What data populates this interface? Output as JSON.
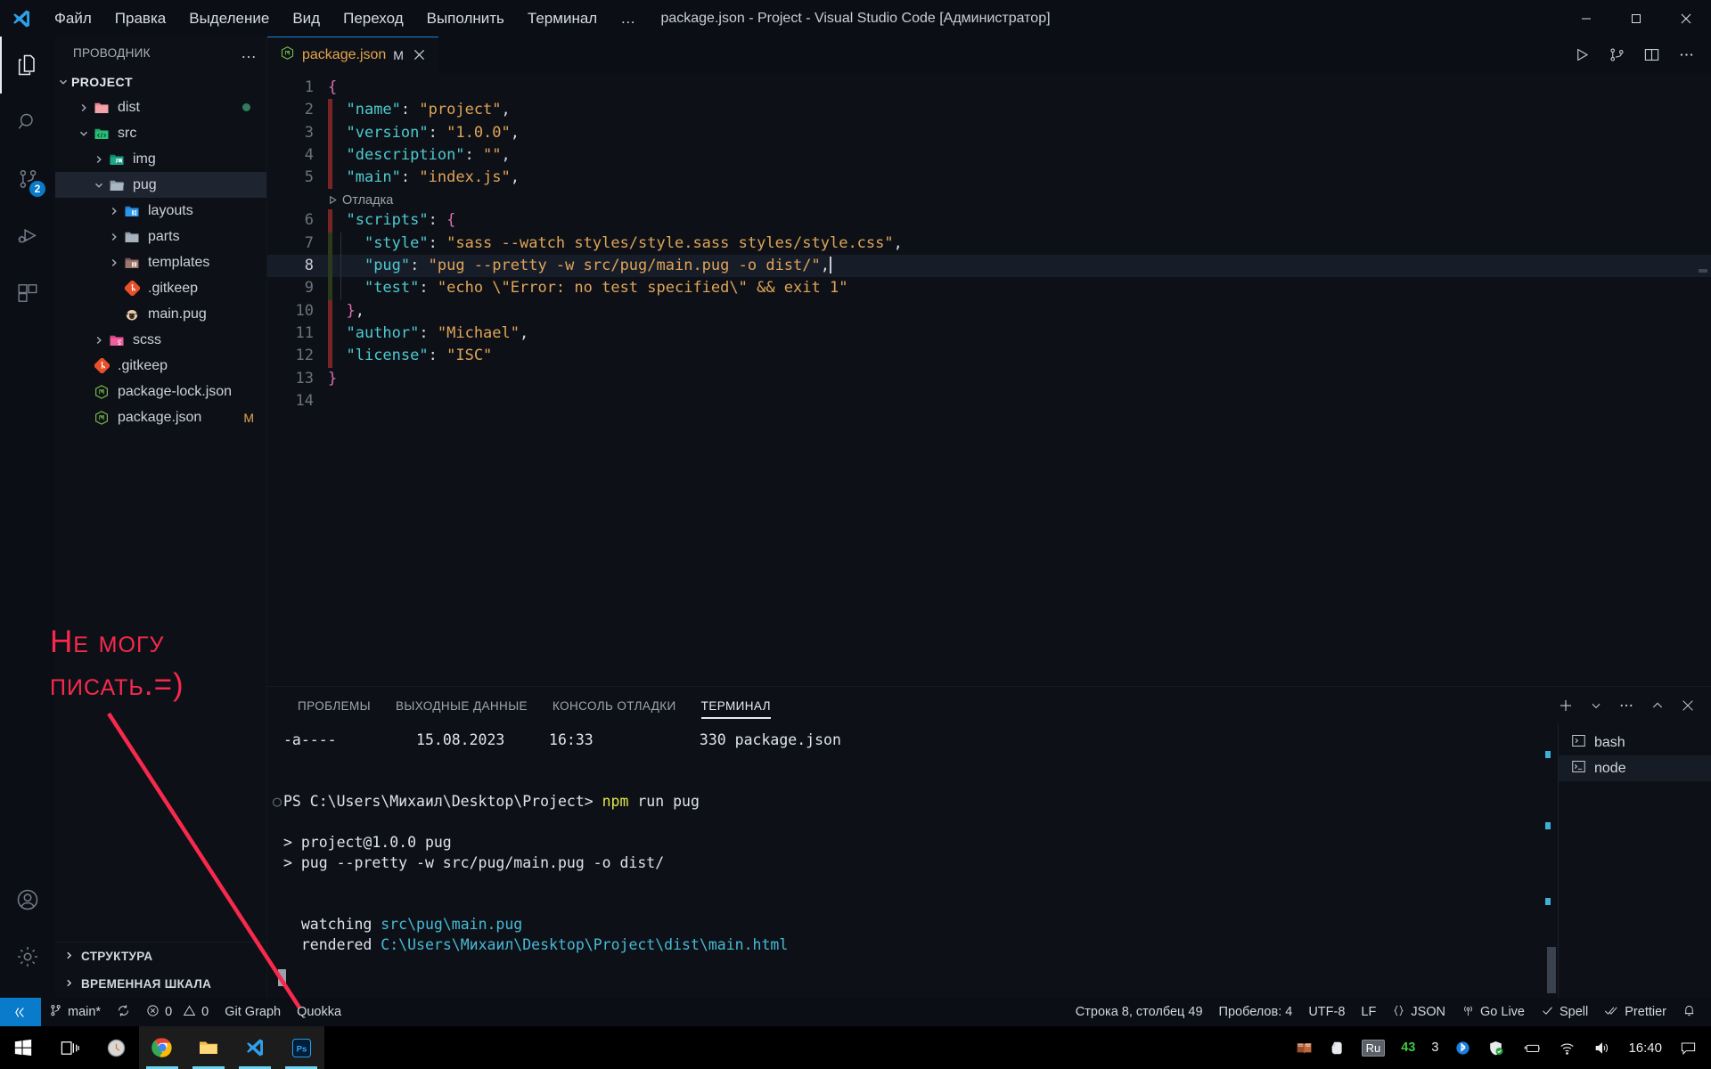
{
  "window": {
    "title": "package.json - Project - Visual Studio Code [Администратор]",
    "minimize": "minimize-icon",
    "maximize": "maximize-icon",
    "close": "close-icon"
  },
  "menu": {
    "items": [
      "Файл",
      "Правка",
      "Выделение",
      "Вид",
      "Переход",
      "Выполнить",
      "Терминал",
      "…"
    ]
  },
  "activitybar": {
    "items": [
      {
        "name": "explorer",
        "icon": "files-icon",
        "badge": ""
      },
      {
        "name": "search",
        "icon": "search-icon",
        "badge": ""
      },
      {
        "name": "source-control",
        "icon": "source-control-icon",
        "badge": "2"
      },
      {
        "name": "run-debug",
        "icon": "run-debug-icon",
        "badge": ""
      },
      {
        "name": "extensions",
        "icon": "extensions-icon",
        "badge": ""
      }
    ],
    "bottom": [
      {
        "name": "accounts",
        "icon": "account-icon"
      },
      {
        "name": "settings",
        "icon": "gear-icon"
      }
    ]
  },
  "sidebar": {
    "title": "ПРОВОДНИК",
    "more": "…",
    "root": "PROJECT",
    "tree": [
      {
        "label": "dist",
        "indent": 1,
        "type": "folder",
        "state": "collapsed",
        "icon": "folder-dist-icon",
        "badge": "",
        "dot": true
      },
      {
        "label": "src",
        "indent": 1,
        "type": "folder",
        "state": "expanded",
        "icon": "folder-src-icon",
        "badge": "",
        "dot": false
      },
      {
        "label": "img",
        "indent": 2,
        "type": "folder",
        "state": "collapsed",
        "icon": "folder-img-icon",
        "badge": "",
        "dot": false
      },
      {
        "label": "pug",
        "indent": 2,
        "type": "folder",
        "state": "expanded",
        "icon": "folder-open-icon",
        "badge": "",
        "dot": false,
        "selected": true
      },
      {
        "label": "layouts",
        "indent": 3,
        "type": "folder",
        "state": "collapsed",
        "icon": "folder-layout-icon",
        "badge": "",
        "dot": false
      },
      {
        "label": "parts",
        "indent": 3,
        "type": "folder",
        "state": "collapsed",
        "icon": "folder-plain-icon",
        "badge": "",
        "dot": false
      },
      {
        "label": "templates",
        "indent": 3,
        "type": "folder",
        "state": "collapsed",
        "icon": "folder-tmpl-icon",
        "badge": "",
        "dot": false
      },
      {
        "label": ".gitkeep",
        "indent": 3,
        "type": "file",
        "state": "",
        "icon": "git-icon",
        "badge": "",
        "dot": false
      },
      {
        "label": "main.pug",
        "indent": 3,
        "type": "file",
        "state": "",
        "icon": "pug-icon",
        "badge": "",
        "dot": false
      },
      {
        "label": "scss",
        "indent": 2,
        "type": "folder",
        "state": "collapsed",
        "icon": "folder-sass-icon",
        "badge": "",
        "dot": false
      },
      {
        "label": ".gitkeep",
        "indent": 1,
        "type": "file",
        "state": "",
        "icon": "git-icon",
        "badge": "",
        "dot": false
      },
      {
        "label": "package-lock.json",
        "indent": 1,
        "type": "file",
        "state": "",
        "icon": "npm-icon",
        "badge": "",
        "dot": false
      },
      {
        "label": "package.json",
        "indent": 1,
        "type": "file",
        "state": "",
        "icon": "npm-icon",
        "badge": "M",
        "dot": false
      }
    ],
    "sections": [
      "СТРУКТУРА",
      "ВРЕМЕННАЯ ШКАЛА"
    ]
  },
  "editor": {
    "tab": {
      "label": "package.json",
      "modified": "M",
      "close": "close-icon",
      "icon": "npm-icon"
    },
    "actions": [
      "run-icon",
      "split-run-icon",
      "split-editor-icon",
      "more-actions-icon"
    ],
    "codelens": "Отладка",
    "lines": [
      {
        "n": "1",
        "text": "{"
      },
      {
        "n": "2",
        "text": "  \"name\": \"project\","
      },
      {
        "n": "3",
        "text": "  \"version\": \"1.0.0\","
      },
      {
        "n": "4",
        "text": "  \"description\": \"\","
      },
      {
        "n": "5",
        "text": "  \"main\": \"index.js\","
      },
      {
        "n": "6",
        "text": "  \"scripts\": {"
      },
      {
        "n": "7",
        "text": "    \"style\": \"sass --watch styles/style.sass styles/style.css\","
      },
      {
        "n": "8",
        "text": "    \"pug\": \"pug --pretty -w src/pug/main.pug -o dist/\","
      },
      {
        "n": "9",
        "text": "    \"test\": \"echo \\\"Error: no test specified\\\" && exit 1\""
      },
      {
        "n": "10",
        "text": "  },"
      },
      {
        "n": "11",
        "text": "  \"author\": \"Michael\","
      },
      {
        "n": "12",
        "text": "  \"license\": \"ISC\""
      },
      {
        "n": "13",
        "text": "}"
      },
      {
        "n": "14",
        "text": ""
      }
    ]
  },
  "annotation": {
    "line1": "Не могу",
    "line2": "писать.=)",
    "color": "#f8294c"
  },
  "panel": {
    "tabs": [
      {
        "label": "ПРОБЛЕМЫ",
        "active": false
      },
      {
        "label": "ВЫХОДНЫЕ ДАННЫЕ",
        "active": false
      },
      {
        "label": "КОНСОЛЬ ОТЛАДКИ",
        "active": false
      },
      {
        "label": "ТЕРМИНАЛ",
        "active": true
      }
    ],
    "actions": [
      "add-terminal-icon",
      "chevron-down-icon",
      "more-actions-icon",
      "chevron-up-icon",
      "close-icon"
    ],
    "terminal": {
      "lines": [
        {
          "text": "-a----         15.08.2023     16:33            330 package.json",
          "color": "white"
        },
        {
          "text": "",
          "color": "white"
        },
        {
          "text": "PS C:\\Users\\Михаил\\Desktop\\Project> npm run pug",
          "color": "prompt"
        },
        {
          "text": "",
          "color": "white"
        },
        {
          "text": "> project@1.0.0 pug",
          "color": "white"
        },
        {
          "text": "> pug --pretty -w src/pug/main.pug -o dist/",
          "color": "white"
        },
        {
          "text": "",
          "color": "white"
        },
        {
          "text": "",
          "color": "white"
        },
        {
          "text": "  watching src\\pug\\main.pug",
          "color": "watch"
        },
        {
          "text": "  rendered C:\\Users\\Михаил\\Desktop\\Project\\dist\\main.html",
          "color": "render"
        }
      ],
      "prompt_path": "PS C:\\Users\\Михаил\\Desktop\\Project>",
      "prompt_cmd_highlight": "npm",
      "prompt_cmd_rest": " run pug",
      "watch_label": "watching",
      "watch_path": "src\\pug\\main.pug",
      "render_label": "rendered",
      "render_path": "C:\\Users\\Михаил\\Desktop\\Project\\dist\\main.html",
      "ls_row": {
        "attrs": "-a----",
        "date": "15.08.2023",
        "time": "16:33",
        "size": "330",
        "name": "package.json"
      }
    },
    "terminals": [
      {
        "label": "bash",
        "icon": "terminal-icon",
        "active": false
      },
      {
        "label": "node",
        "icon": "terminal-node-icon",
        "active": true
      }
    ]
  },
  "statusbar": {
    "remote": "remote-icon",
    "left": [
      {
        "name": "branch",
        "icon": "branch-icon",
        "label": "main*"
      },
      {
        "name": "sync",
        "icon": "sync-icon",
        "label": ""
      },
      {
        "name": "errors",
        "icon": "error-icon",
        "label": "0"
      },
      {
        "name": "warnings",
        "icon": "warning-icon",
        "label": "0"
      },
      {
        "name": "git-graph",
        "icon": "",
        "label": "Git Graph"
      },
      {
        "name": "quokka",
        "icon": "",
        "label": "Quokka"
      }
    ],
    "right": [
      {
        "name": "cursor-position",
        "icon": "",
        "label": "Строка 8, столбец 49"
      },
      {
        "name": "indentation",
        "icon": "",
        "label": "Пробелов: 4"
      },
      {
        "name": "encoding",
        "icon": "",
        "label": "UTF-8"
      },
      {
        "name": "eol",
        "icon": "",
        "label": "LF"
      },
      {
        "name": "language-mode",
        "icon": "json-icon",
        "label": "JSON"
      },
      {
        "name": "go-live",
        "icon": "broadcast-icon",
        "label": "Go Live"
      },
      {
        "name": "spell",
        "icon": "check-icon",
        "label": "Spell"
      },
      {
        "name": "prettier",
        "icon": "check-double-icon",
        "label": "Prettier"
      },
      {
        "name": "notifications",
        "icon": "bell-icon",
        "label": ""
      }
    ]
  },
  "taskbar": {
    "buttons": [
      {
        "name": "start",
        "icon": "windows-icon",
        "open": false
      },
      {
        "name": "task-view",
        "icon": "task-view-icon",
        "open": false
      },
      {
        "name": "clock-app",
        "icon": "clock-icon",
        "open": false
      },
      {
        "name": "chrome",
        "icon": "chrome-icon",
        "open": true
      },
      {
        "name": "file-explorer",
        "icon": "folder-icon",
        "open": true
      },
      {
        "name": "vscode",
        "icon": "vscode-icon",
        "open": true
      },
      {
        "name": "photoshop",
        "icon": "photoshop-icon",
        "open": true
      }
    ],
    "tray": [
      {
        "name": "book",
        "icon": "book-icon",
        "label": ""
      },
      {
        "name": "evernote",
        "icon": "evernote-icon",
        "label": ""
      },
      {
        "name": "language",
        "icon": "",
        "label": "Ru"
      },
      {
        "name": "counter-43",
        "icon": "",
        "label": "43"
      },
      {
        "name": "counter-3",
        "icon": "",
        "label": "3"
      },
      {
        "name": "bluetooth",
        "icon": "bluetooth-icon",
        "label": ""
      },
      {
        "name": "defender",
        "icon": "shield-icon",
        "label": ""
      },
      {
        "name": "battery",
        "icon": "battery-icon",
        "label": ""
      },
      {
        "name": "wifi",
        "icon": "wifi-icon",
        "label": ""
      },
      {
        "name": "volume",
        "icon": "volume-icon",
        "label": ""
      }
    ],
    "clock": "16:40",
    "action_center": "action-center-icon"
  }
}
